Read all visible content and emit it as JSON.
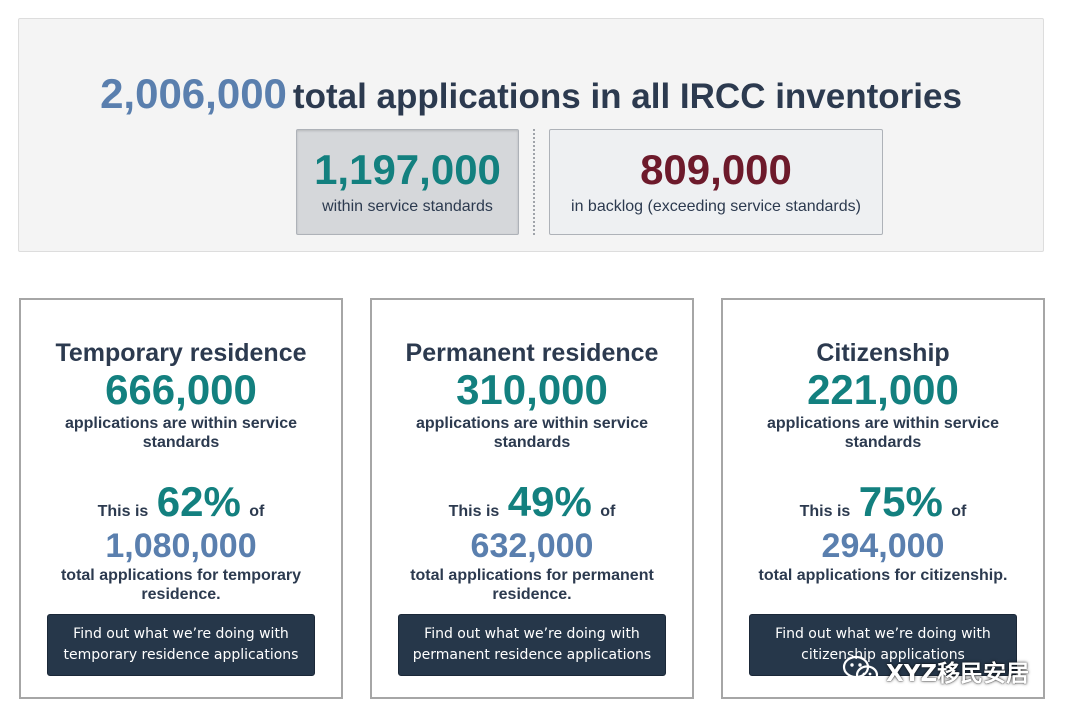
{
  "summary": {
    "total_number": "2,006,000",
    "total_text": "total applications in all IRCC inventories",
    "within": {
      "number": "1,197,000",
      "label": "within service standards"
    },
    "backlog": {
      "number": "809,000",
      "label": "in backlog (exceeding service standards)"
    }
  },
  "cards": [
    {
      "title": "Temporary residence",
      "within_number": "666,000",
      "within_text": "applications are within service standards",
      "this_is": "This is",
      "percent": "62%",
      "of": "of",
      "total_number": "1,080,000",
      "total_text": "total applications for temporary residence.",
      "button_label": "Find out what we’re doing with temporary residence applications"
    },
    {
      "title": "Permanent residence",
      "within_number": "310,000",
      "within_text": "applications are within service standards",
      "this_is": "This is",
      "percent": "49%",
      "of": "of",
      "total_number": "632,000",
      "total_text": "total applications for permanent residence.",
      "button_label": "Find out what we’re doing with permanent residence applications"
    },
    {
      "title": "Citizenship",
      "within_number": "221,000",
      "within_text": "applications are within service standards",
      "this_is": "This is",
      "percent": "75%",
      "of": "of",
      "total_number": "294,000",
      "total_text": "total applications for citizenship.",
      "button_label": "Find out what we’re doing with citizenship applications"
    }
  ],
  "watermark": {
    "text": "XYZ移民安居",
    "icon": "wechat-icon"
  },
  "colors": {
    "teal": "#13807f",
    "blue": "#5a7fae",
    "maroon": "#6d1a2b",
    "navy": "#26374a",
    "text": "#2c3a4f"
  }
}
